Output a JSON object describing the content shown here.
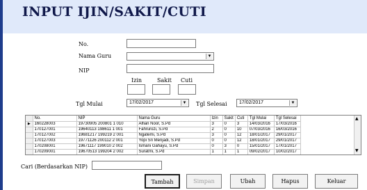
{
  "title": "INPUT IJIN/SAKIT/CUTI",
  "form": {
    "no_label": "No.",
    "nama_guru_label": "Nama Guru",
    "nip_label": "NIP",
    "izin_label": "Izin",
    "sakit_label": "Sakit",
    "cuti_label": "Cuti",
    "tgl_mulai_label": "Tgl Mulai",
    "tgl_mulai_value": "17/02/2017",
    "tgl_selesai_label": "Tgl Selesai",
    "tgl_selesai_value": "17/02/2017",
    "no_value": "",
    "nama_guru_value": "",
    "nip_value": "",
    "izin_value": "",
    "sakit_value": "",
    "cuti_value": ""
  },
  "table": {
    "columns": [
      "No.",
      "NIP",
      "Nama Guru",
      "Izin",
      "Sakit",
      "Cuti",
      "Tgl Mulai",
      "Tgl Selesai"
    ],
    "rows": [
      [
        "160228003",
        "19730905 200801 1 010",
        "Alfian Noor, S.Pd",
        "3",
        "0",
        "3",
        "14/03/2016",
        "17/03/2016"
      ],
      [
        "170127001",
        "19640113 198611 1 001",
        "Fahrurozi, S.Pd",
        "2",
        "0",
        "10",
        "07/03/2016",
        "16/03/2016"
      ],
      [
        "170127002",
        "19681217 199219 2 001",
        "Ngatemi, S.Pd",
        "3",
        "0",
        "12",
        "18/01/2017",
        "29/01/2017"
      ],
      [
        "170127003",
        "19771126 200112 2 001",
        "Yopi Sri Menjadi, S.Pd",
        "0",
        "0",
        "12",
        "18/01/2017",
        "29/01/2017"
      ],
      [
        "170208001",
        "19671117 199010 2 002",
        "Ismani Gahayu, S.Pd",
        "0",
        "3",
        "0",
        "15/01/2017",
        "17/01/2017"
      ],
      [
        "170209001",
        "19670513 199204 2 002",
        "Suratmi, S.Pd",
        "1",
        "1",
        "1",
        "09/02/2017",
        "10/02/2017"
      ]
    ],
    "selected_indicator": "▶"
  },
  "search": {
    "label": "Cari (Berdasarkan NIP)",
    "value": ""
  },
  "buttons": {
    "tambah": "Tambah",
    "simpan": "Simpan",
    "ubah": "Ubah",
    "hapus": "Hapus",
    "keluar": "Keluar"
  },
  "icons": {
    "combo_arrow": "▼",
    "scroll_up": "▲",
    "scroll_down": "▼"
  },
  "colors": {
    "header_bg": "#e0e9fa",
    "title_color": "#10184a",
    "left_border": "#1e3c8c"
  }
}
